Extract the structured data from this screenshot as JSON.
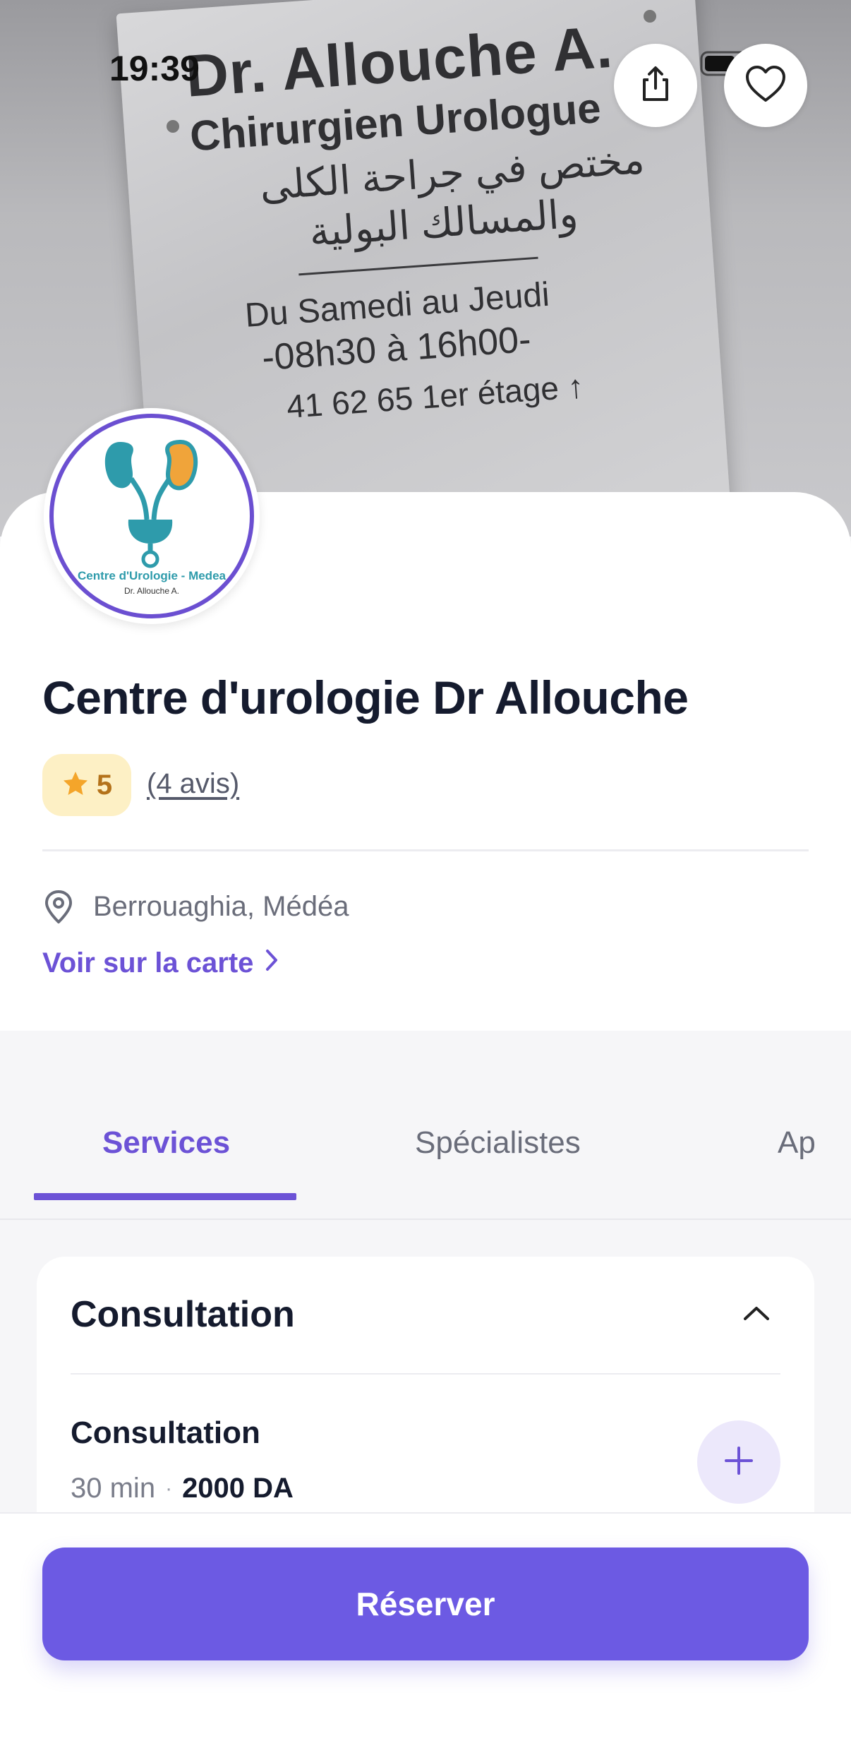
{
  "status_bar": {
    "time": "19:39"
  },
  "hero": {
    "sign_line1": "Dr. Allouche A.",
    "sign_line2": "Chirurgien Urologue",
    "sign_line3": "مختص في جراحة الكلى",
    "sign_line4": "والمسالك البولية",
    "sign_line5": "Du Samedi au Jeudi",
    "sign_line6": "-08h30 à 16h00-",
    "sign_line7": "41 62 65     1er étage ↑"
  },
  "logo": {
    "name": "Centre d'Urologie - Medea",
    "subtitle": "Dr. Allouche A."
  },
  "clinic": {
    "title": "Centre d'urologie Dr Allouche",
    "rating": "5",
    "reviews": "(4 avis)",
    "location": "Berrouaghia, Médéa",
    "map_link": "Voir sur la carte"
  },
  "tabs": [
    {
      "label": "Services"
    },
    {
      "label": "Spécialistes"
    },
    {
      "label": "Ap"
    }
  ],
  "section": {
    "title": "Consultation",
    "service": {
      "name": "Consultation",
      "duration": "30 min",
      "separator": "·",
      "price": "2000 DA"
    }
  },
  "bottom": {
    "book_label": "Réserver"
  },
  "colors": {
    "accent": "#6c52d6",
    "button": "#6c5ae3",
    "star": "#f4a52a",
    "badge_bg": "#fdf0c5"
  }
}
